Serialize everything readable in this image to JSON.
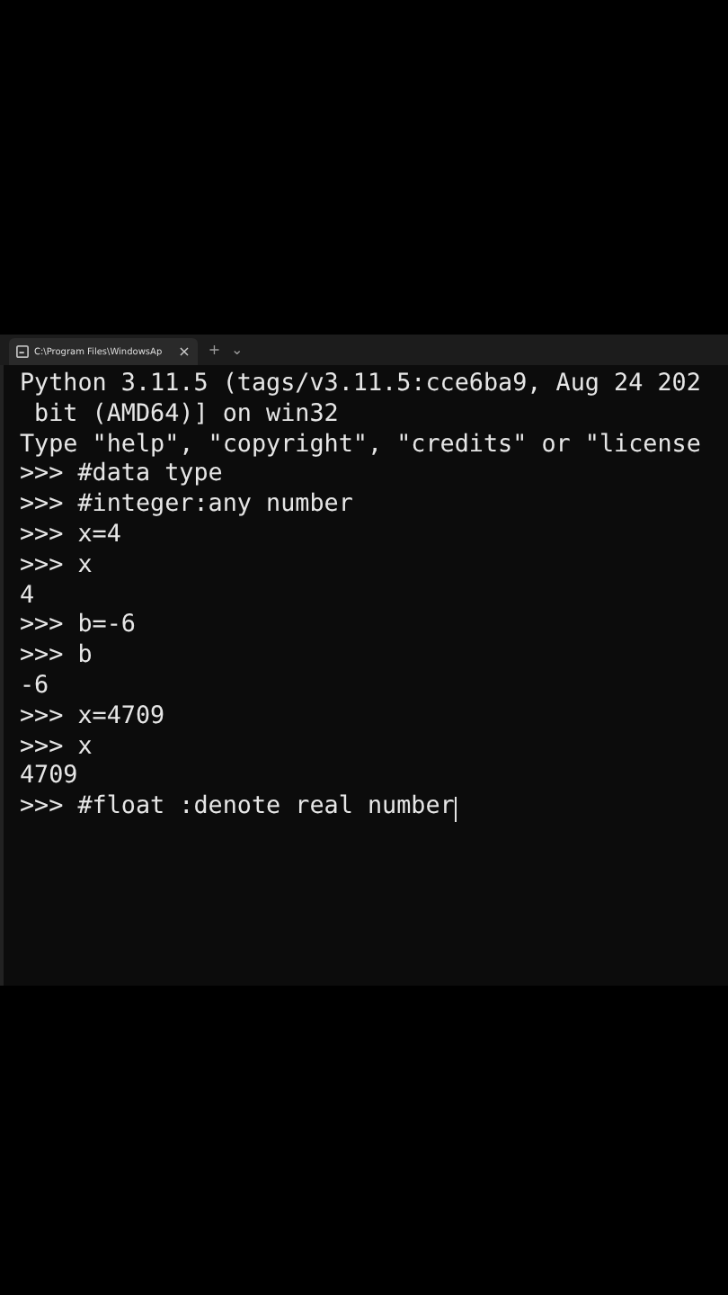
{
  "tabs": [
    {
      "title": "C:\\Program Files\\WindowsAp",
      "close": "×",
      "selected": true
    }
  ],
  "new_tab": "+",
  "dropdown": "⌄",
  "lines": [
    {
      "kind": "output",
      "text": "Python 3.11.5 (tags/v3.11.5:cce6ba9, Aug 24 202"
    },
    {
      "kind": "output",
      "text": " bit (AMD64)] on win32"
    },
    {
      "kind": "output",
      "text": "Type \"help\", \"copyright\", \"credits\" or \"license"
    },
    {
      "kind": "input",
      "prompt": ">>>",
      "text": "#data type"
    },
    {
      "kind": "input",
      "prompt": ">>>",
      "text": "#integer:any number"
    },
    {
      "kind": "input",
      "prompt": ">>>",
      "text": "x=4"
    },
    {
      "kind": "input",
      "prompt": ">>>",
      "text": "x"
    },
    {
      "kind": "output",
      "text": "4"
    },
    {
      "kind": "input",
      "prompt": ">>>",
      "text": "b=-6"
    },
    {
      "kind": "input",
      "prompt": ">>>",
      "text": "b"
    },
    {
      "kind": "output",
      "text": "-6"
    },
    {
      "kind": "input",
      "prompt": ">>>",
      "text": "x=4709"
    },
    {
      "kind": "input",
      "prompt": ">>>",
      "text": "x"
    },
    {
      "kind": "output",
      "text": "4709"
    },
    {
      "kind": "input",
      "prompt": ">>>",
      "text": "#float :denote real number",
      "cursor": true
    }
  ]
}
